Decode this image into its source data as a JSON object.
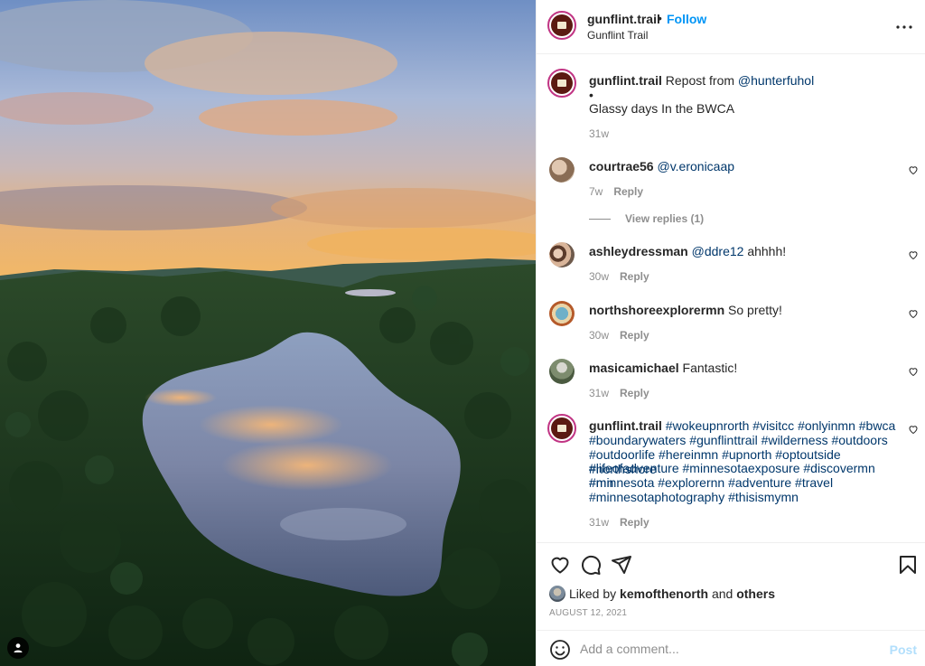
{
  "post": {
    "username": "gunflint.trail",
    "follow_label": "Follow",
    "separator": "•",
    "location": "Gunflint Trail"
  },
  "caption": {
    "username": "gunflint.trail",
    "text_prefix": "Repost from",
    "mention": "@hunterfuhol",
    "bullet": "•",
    "line2": "Glassy days In the BWCA",
    "time": "31w"
  },
  "comments": [
    {
      "username": "courtrae56",
      "mention": "@v.eronicaap",
      "text": "",
      "time": "7w",
      "reply_label": "Reply"
    },
    {
      "username": "ashleydressman",
      "mention": "@ddre12",
      "text": " ahhhh!",
      "time": "30w",
      "reply_label": "Reply"
    },
    {
      "username": "northshoreexplorermn",
      "mention": "",
      "text": " So pretty!",
      "time": "30w",
      "reply_label": "Reply"
    },
    {
      "username": "masicamichael",
      "mention": "",
      "text": " Fantastic!",
      "time": "31w",
      "reply_label": "Reply"
    }
  ],
  "view_replies": "View replies (1)",
  "hashtag_comment": {
    "username": "gunflint.trail",
    "lines": [
      "#wokeupnrorth #visitcc #onlyinmn #bwca",
      "#boundarywaters #gunflinttrail #wilderness #outdoors",
      "#outdoorlife #hereinmn #upnorth #optoutside #northshore",
      "#lifeofadventure #minnesotaexposure #discovermn #mn",
      "#minnesota #explorernn #adventure #travel",
      "#minnesotaphotography #thisismymn"
    ],
    "time": "31w",
    "reply_label": "Reply"
  },
  "likes": {
    "prefix": "Liked by",
    "user": "kemofthenorth",
    "middle": "and",
    "others": "others"
  },
  "date": "AUGUST 12, 2021",
  "add_comment": {
    "placeholder": "Add a comment...",
    "post_label": "Post"
  },
  "icons": {
    "like": "heart-icon",
    "comment": "comment-icon",
    "share": "paper-plane-icon",
    "save": "bookmark-icon",
    "emoji": "smiley-icon",
    "more": "more-dots-icon",
    "tag": "user-tag-icon"
  },
  "colors": {
    "link_blue": "#0095f6",
    "hashtag_blue": "#00376b",
    "muted": "#8e8e8e",
    "text": "#262626",
    "post_disabled": "#b2dffc"
  }
}
